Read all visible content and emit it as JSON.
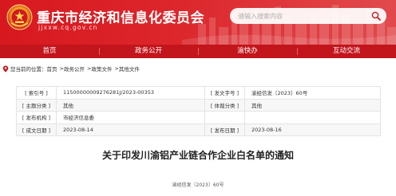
{
  "site": {
    "title": "重庆市经济和信息化委员会",
    "domain": "jjxxw.cq.gov.cn"
  },
  "search": {
    "placeholder": "请输入搜索内容"
  },
  "nav": {
    "items": [
      {
        "label": "首页"
      },
      {
        "label": "政务公开"
      },
      {
        "label": "渝快办"
      },
      {
        "label": "互动交流"
      }
    ]
  },
  "breadcrumb": {
    "prefix": "您当前的位置：",
    "separator": ">",
    "items": [
      "首页",
      "政务公开",
      "政策文件",
      "其他文件"
    ]
  },
  "meta": {
    "rows": [
      [
        {
          "label": "[ 索引号 ]",
          "value": "11500000009276281J/2023-00353"
        },
        {
          "label": "[ 发文字号 ]",
          "value": "渝经信发〔2023〕60号"
        }
      ],
      [
        {
          "label": "[ 主题分类 ]",
          "value": "其他"
        },
        {
          "label": "[ 体裁分类 ]",
          "value": "其他"
        }
      ],
      [
        {
          "label": "[ 发布机构 ]",
          "value": "市经济信息委"
        }
      ],
      [
        {
          "label": "[ 成文日期 ]",
          "value": "2023-08-14"
        },
        {
          "label": "[ 发布日期 ]",
          "value": "2023-08-16"
        }
      ]
    ]
  },
  "article": {
    "title": "关于印发川渝铝产业链合作企业白名单的通知",
    "doc_number": "渝经信发〔2023〕60号"
  },
  "colors": {
    "header_red": "#d8181f",
    "nav_red": "#c3151c",
    "text": "#333333",
    "table_border": "#e4e4e4"
  },
  "icons": {
    "logo": "emblem-logo",
    "search": "search-icon",
    "location": "location-pin-icon"
  }
}
